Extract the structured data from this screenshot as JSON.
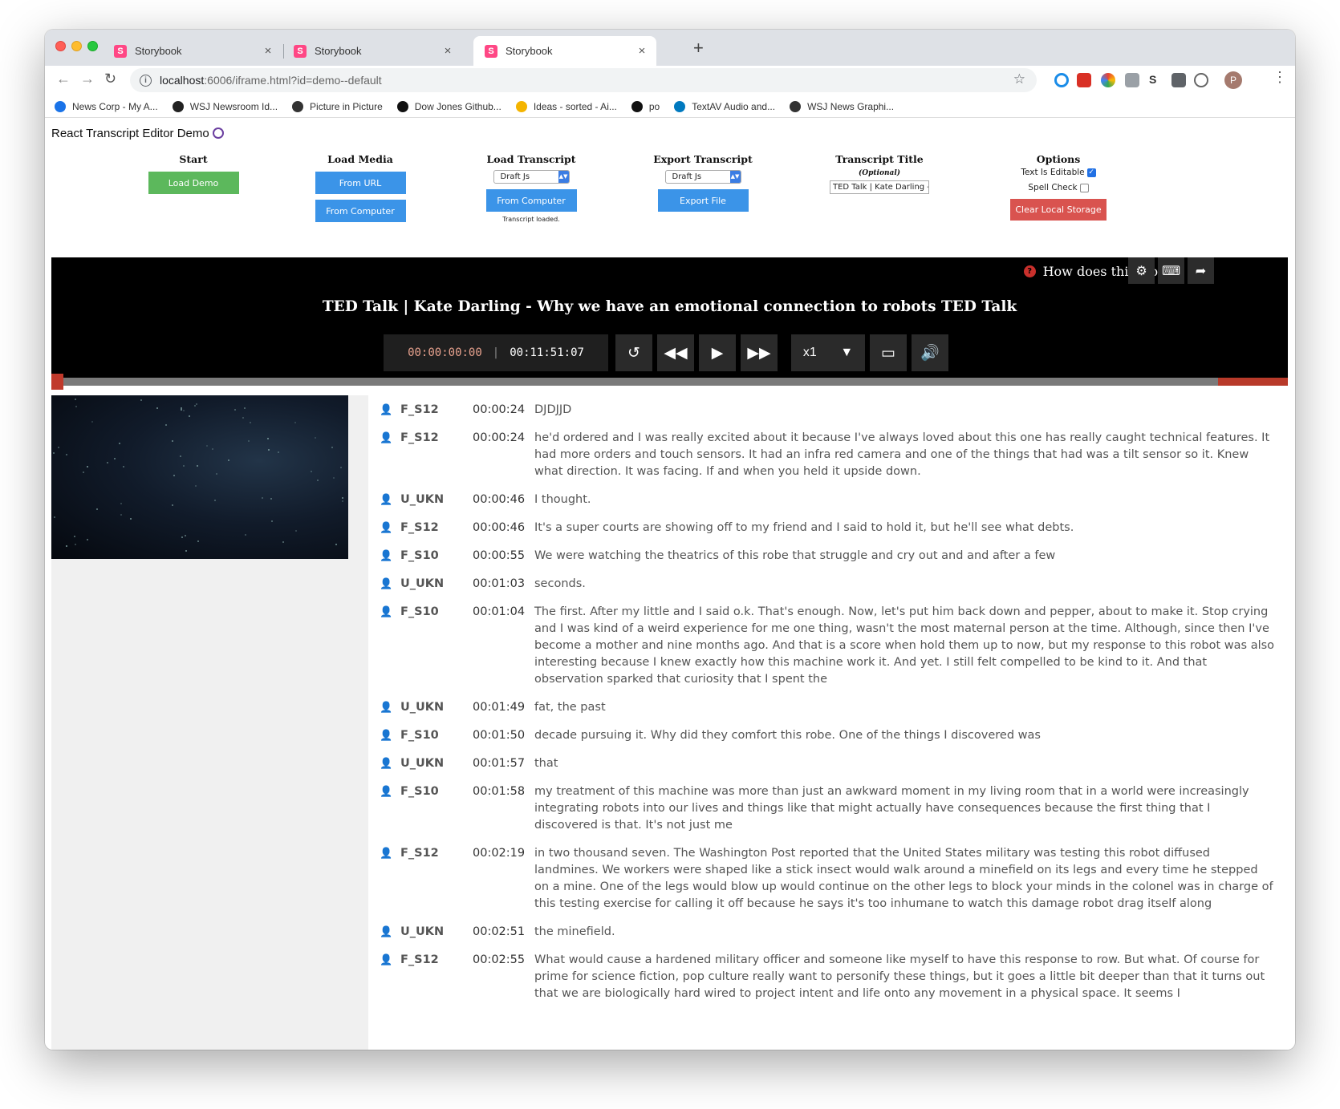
{
  "browser": {
    "tabs": [
      {
        "title": "Storybook",
        "favicon": "S"
      },
      {
        "title": "Storybook",
        "favicon": "S"
      },
      {
        "title": "Storybook",
        "favicon": "S"
      }
    ],
    "url_host": "localhost",
    "url_rest": ":6006/iframe.html?id=demo--default",
    "avatar_letter": "P",
    "bookmarks": [
      {
        "label": "News Corp - My A...",
        "icon_color": "#1a73e8"
      },
      {
        "label": "WSJ Newsroom Id...",
        "icon_color": "#222222"
      },
      {
        "label": "Picture in Picture",
        "icon_color": "#333333"
      },
      {
        "label": "Dow Jones Github...",
        "icon_color": "#111111"
      },
      {
        "label": "Ideas - sorted - Ai...",
        "icon_color": "#f4b400"
      },
      {
        "label": "po",
        "icon_color": "#111111"
      },
      {
        "label": "TextAV Audio and...",
        "icon_color": "#0079bf"
      },
      {
        "label": "WSJ News Graphi...",
        "icon_color": "#333333"
      }
    ]
  },
  "app": {
    "title": "React Transcript Editor Demo",
    "start": {
      "heading": "Start",
      "load_demo": "Load Demo"
    },
    "load_media": {
      "heading": "Load Media",
      "from_url": "From URL",
      "from_computer": "From Computer"
    },
    "load_transcript": {
      "heading": "Load Transcript",
      "format": "Draft Js",
      "from_computer": "From Computer",
      "status": "Transcript loaded."
    },
    "export_transcript": {
      "heading": "Export Transcript",
      "format": "Draft Js",
      "export_file": "Export File"
    },
    "transcript_title": {
      "heading": "Transcript Title",
      "optional": "(Optional)",
      "value": "TED Talk | Kate Darling - Why we have an emotional connection to robots TED Talk"
    },
    "options": {
      "heading": "Options",
      "text_editable": "Text Is Editable",
      "spell_check": "Spell Check",
      "clear_storage": "Clear Local Storage"
    }
  },
  "player": {
    "help": "How does this work?",
    "video_title": "TED Talk | Kate Darling - Why we have an emotional connection to robots TED Talk",
    "current_time": "00:00:00:00",
    "duration": "00:11:51:07",
    "playback_rate": "x1",
    "progress_fraction": 0.0
  },
  "transcript": [
    {
      "speaker": "F_S12",
      "time": "00:00:24",
      "text": "DJDJJD"
    },
    {
      "speaker": "F_S12",
      "time": "00:00:24",
      "text": "he'd ordered and I was really excited about it because I've always loved about this one has really caught technical features. It had more orders and touch sensors. It had an infra red camera and one of the things that had was a tilt sensor so it. Knew what direction. It was facing. If and when you held it upside down."
    },
    {
      "speaker": "U_UKN",
      "time": "00:00:46",
      "text": "I thought."
    },
    {
      "speaker": "F_S12",
      "time": "00:00:46",
      "text": "It's a super courts are showing off to my friend and I said to hold it, but he'll see what debts."
    },
    {
      "speaker": "F_S10",
      "time": "00:00:55",
      "text": "We were watching the theatrics of this robe that struggle and cry out and and after a few"
    },
    {
      "speaker": "U_UKN",
      "time": "00:01:03",
      "text": "seconds."
    },
    {
      "speaker": "F_S10",
      "time": "00:01:04",
      "text": "The first. After my little and I said o.k. That's enough. Now, let's put him back down and pepper, about to make it. Stop crying and I was kind of a weird experience for me one thing, wasn't the most maternal person at the time. Although, since then I've become a mother and nine months ago. And that is a score when hold them up to now, but my response to this robot was also interesting because I knew exactly how this machine work it. And yet. I still felt compelled to be kind to it. And that observation sparked that curiosity that I spent the"
    },
    {
      "speaker": "U_UKN",
      "time": "00:01:49",
      "text": "fat, the past"
    },
    {
      "speaker": "F_S10",
      "time": "00:01:50",
      "text": "decade pursuing it. Why did they comfort this robe. One of the things I discovered was"
    },
    {
      "speaker": "U_UKN",
      "time": "00:01:57",
      "text": "that"
    },
    {
      "speaker": "F_S10",
      "time": "00:01:58",
      "text": "my treatment of this machine was more than just an awkward moment in my living room that in a world were increasingly integrating robots into our lives and things like that might actually have consequences because the first thing that I discovered is that. It's not just me"
    },
    {
      "speaker": "F_S12",
      "time": "00:02:19",
      "text": "in two thousand seven. The Washington Post reported that the United States military was testing this robot diffused landmines. We workers were shaped like a stick insect would walk around a minefield on its legs and every time he stepped on a mine. One of the legs would blow up would continue on the other legs to block your minds in the colonel was in charge of this testing exercise for calling it off because he says it's too inhumane to watch this damage robot drag itself along"
    },
    {
      "speaker": "U_UKN",
      "time": "00:02:51",
      "text": "the minefield."
    },
    {
      "speaker": "F_S12",
      "time": "00:02:55",
      "text": "What would cause a hardened military officer and someone like myself to have this response to row. But what. Of course for prime for science fiction, pop culture really want to personify these things, but it goes a little bit deeper than that it turns out that we are biologically hard wired to project intent and life onto any movement in a physical space. It seems I"
    }
  ]
}
